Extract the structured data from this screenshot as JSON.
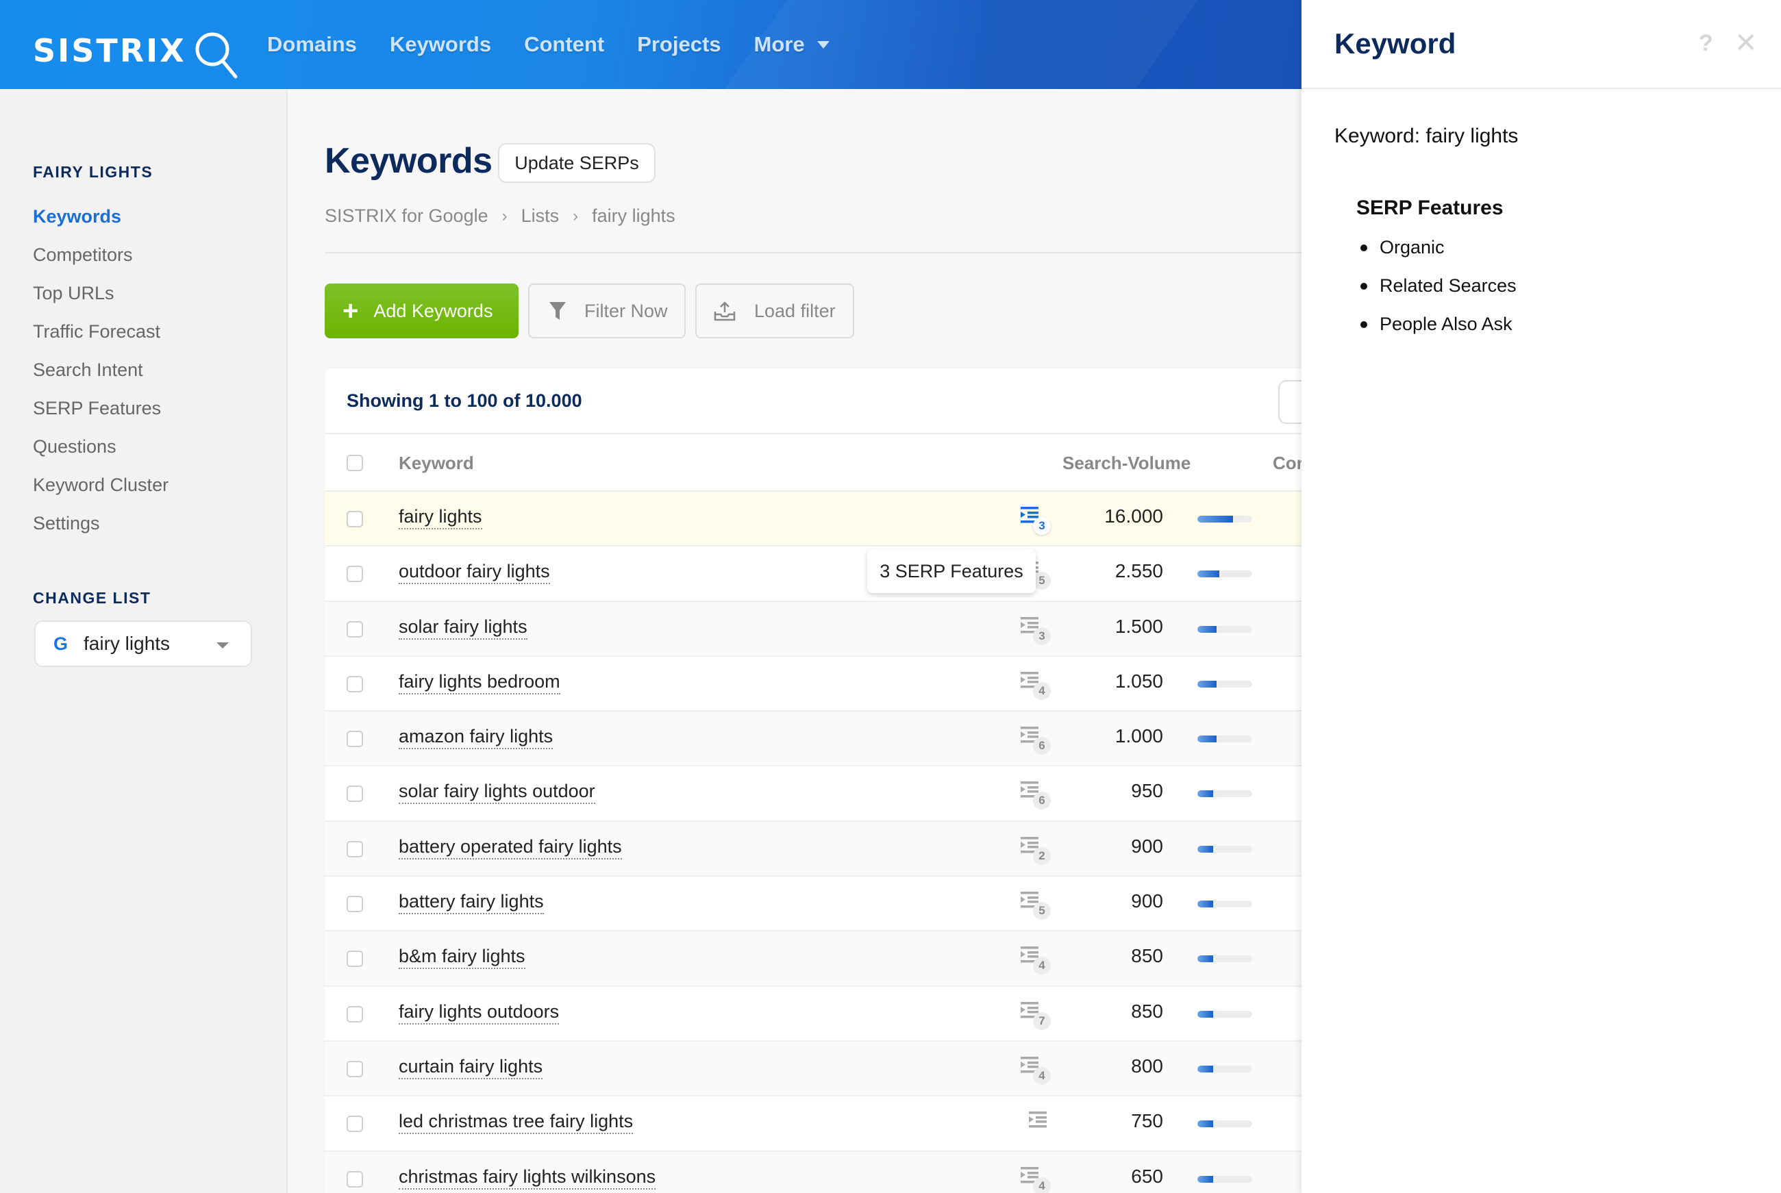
{
  "header": {
    "logo_text": "SISTRIX",
    "nav": [
      {
        "label": "Domains"
      },
      {
        "label": "Keywords"
      },
      {
        "label": "Content"
      },
      {
        "label": "Projects"
      },
      {
        "label": "More",
        "has_dropdown": true
      }
    ]
  },
  "sidebar": {
    "section_title": "FAIRY LIGHTS",
    "items": [
      {
        "label": "Keywords",
        "active": true
      },
      {
        "label": "Competitors"
      },
      {
        "label": "Top URLs"
      },
      {
        "label": "Traffic Forecast"
      },
      {
        "label": "Search Intent"
      },
      {
        "label": "SERP Features"
      },
      {
        "label": "Questions"
      },
      {
        "label": "Keyword Cluster"
      },
      {
        "label": "Settings"
      }
    ],
    "change_list_title": "CHANGE LIST",
    "list_select": {
      "icon": "google-g-icon",
      "value": "fairy lights"
    }
  },
  "main": {
    "title": "Keywords",
    "update_button": "Update SERPs",
    "breadcrumb": [
      "SISTRIX for Google",
      "Lists",
      "fairy lights"
    ],
    "breadcrumb_separator": "›",
    "buttons": {
      "add_keywords": "Add Keywords",
      "filter_now": "Filter Now",
      "load_filter": "Load filter"
    },
    "table": {
      "showing": "Showing 1 to 100 of 10.000",
      "columns": [
        "Keyword",
        "Search-Volume",
        "Con"
      ],
      "rows": [
        {
          "keyword": "fairy lights",
          "serp_features": "3",
          "volume": "16.000",
          "volume_bar_pct": 65,
          "highlighted": true
        },
        {
          "keyword": "outdoor fairy lights",
          "serp_features": "5",
          "volume": "2.550",
          "volume_bar_pct": 40
        },
        {
          "keyword": "solar fairy lights",
          "serp_features": "3",
          "volume": "1.500",
          "volume_bar_pct": 35
        },
        {
          "keyword": "fairy lights bedroom",
          "serp_features": "4",
          "volume": "1.050",
          "volume_bar_pct": 35
        },
        {
          "keyword": "amazon fairy lights",
          "serp_features": "6",
          "volume": "1.000",
          "volume_bar_pct": 35
        },
        {
          "keyword": "solar fairy lights outdoor",
          "serp_features": "6",
          "volume": "950",
          "volume_bar_pct": 29
        },
        {
          "keyword": "battery operated fairy lights",
          "serp_features": "2",
          "volume": "900",
          "volume_bar_pct": 29
        },
        {
          "keyword": "battery fairy lights",
          "serp_features": "5",
          "volume": "900",
          "volume_bar_pct": 29
        },
        {
          "keyword": "b&m fairy lights",
          "serp_features": "4",
          "volume": "850",
          "volume_bar_pct": 29
        },
        {
          "keyword": "fairy lights outdoors",
          "serp_features": "7",
          "volume": "850",
          "volume_bar_pct": 29
        },
        {
          "keyword": "curtain fairy lights",
          "serp_features": "4",
          "volume": "800",
          "volume_bar_pct": 29
        },
        {
          "keyword": "led christmas tree fairy lights",
          "serp_features": "",
          "volume": "750",
          "volume_bar_pct": 29
        },
        {
          "keyword": "christmas fairy lights wilkinsons",
          "serp_features": "4",
          "volume": "650",
          "volume_bar_pct": 29
        }
      ]
    },
    "tooltip": "3 SERP Features"
  },
  "panel": {
    "title": "Keyword",
    "help_icon": "?",
    "close_icon": "✕",
    "keyword_line": "Keyword: fairy lights",
    "serp_title": "SERP Features",
    "serp_features": [
      "Organic",
      "Related Searces",
      "People Also Ask"
    ]
  },
  "colors": {
    "header_start": "#168ded",
    "header_end": "#1a53b8",
    "brand_navy": "#0c2b5c",
    "link_blue": "#1a6fd4",
    "green_button": "#6bb400",
    "highlight_row": "#fefdeb"
  }
}
